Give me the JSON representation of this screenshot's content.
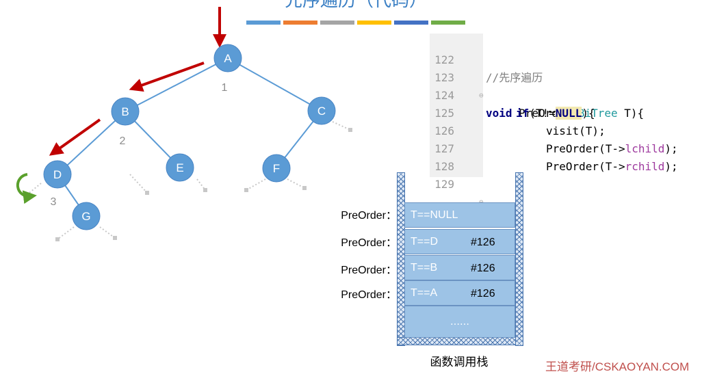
{
  "title": "先序遍历（代码）",
  "color_bar_colors": [
    "#5b9bd5",
    "#ed7d31",
    "#a5a5a5",
    "#ffc000",
    "#4472c4",
    "#70ad47"
  ],
  "tree": {
    "nodes": [
      {
        "id": "A",
        "label": "A",
        "order": "1"
      },
      {
        "id": "B",
        "label": "B",
        "order": "2"
      },
      {
        "id": "C",
        "label": "C",
        "order": ""
      },
      {
        "id": "D",
        "label": "D",
        "order": "3"
      },
      {
        "id": "E",
        "label": "E",
        "order": ""
      },
      {
        "id": "F",
        "label": "F",
        "order": ""
      },
      {
        "id": "G",
        "label": "G",
        "order": ""
      }
    ],
    "node_color": "#5b9bd5",
    "edge_color": "#5b9bd5",
    "arrow_color": "#c00000",
    "loop_color": "#5aa02c"
  },
  "code": {
    "lines": [
      {
        "num": "122",
        "text": "//先序遍历"
      },
      {
        "num": "123",
        "text": "void PreOrder(BiTree T){"
      },
      {
        "num": "124",
        "text": "if(T!=NULL){"
      },
      {
        "num": "125",
        "text": "visit(T);"
      },
      {
        "num": "126",
        "text": "PreOrder(T->lchild);"
      },
      {
        "num": "127",
        "text": "PreOrder(T->rchild);"
      },
      {
        "num": "128",
        "text": "}"
      },
      {
        "num": "129",
        "text": "}"
      }
    ]
  },
  "stack": {
    "frames": [
      {
        "label": "PreOrder：",
        "cond": "T==NULL",
        "ret": ""
      },
      {
        "label": "PreOrder：",
        "cond": "T==D",
        "ret": "#126"
      },
      {
        "label": "PreOrder：",
        "cond": "T==B",
        "ret": "#126"
      },
      {
        "label": "PreOrder：",
        "cond": "T==A",
        "ret": "#126"
      }
    ],
    "bottom": "……",
    "caption": "函数调用栈"
  },
  "watermark": "王道考研/CSKAOYAN.COM"
}
